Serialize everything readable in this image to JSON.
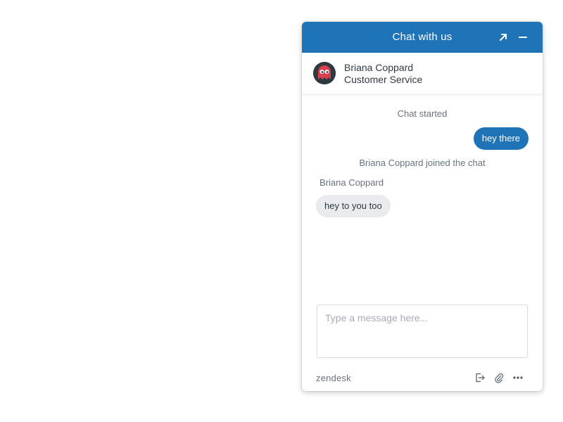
{
  "widget": {
    "header": {
      "title": "Chat with us",
      "buttons": [
        {
          "name": "popout",
          "icon": "arrow-up-right-icon"
        },
        {
          "name": "minimize",
          "icon": "minus-icon"
        }
      ]
    },
    "agent": {
      "name": "Briana Coppard",
      "role": "Customer Service",
      "avatar_icon": "ghost-avatar-icon"
    },
    "messages": {
      "started": "Chat started",
      "visitor_message": "hey there",
      "joined": "Briana Coppard joined the chat",
      "agent_label": "Briana Coppard",
      "agent_message": "hey to you too"
    },
    "input": {
      "value": "",
      "placeholder": "Type a message here..."
    },
    "footer": {
      "brand": "zendesk",
      "buttons": [
        {
          "name": "end-chat",
          "icon": "exit-door-icon"
        },
        {
          "name": "attach",
          "icon": "paperclip-icon"
        },
        {
          "name": "more",
          "icon": "ellipsis-icon"
        }
      ]
    }
  },
  "colors": {
    "brand": "#1f73b7",
    "agent_bubble": "#e9ebed",
    "muted_text": "#68737d",
    "text": "#2f3941"
  }
}
